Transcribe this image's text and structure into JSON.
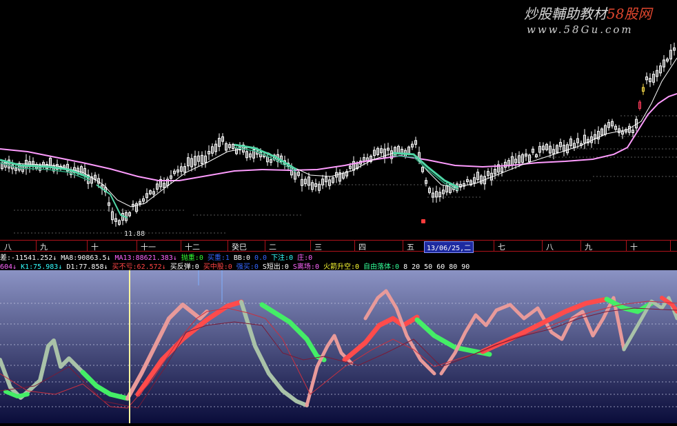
{
  "watermark": {
    "title_main": "炒股輔助教材",
    "title_accent": "58股网",
    "url": "www.58Gu.com"
  },
  "upper_chart": {
    "low_label": "11.88",
    "marker_icon": "red-signal-marker",
    "colors": {
      "candles": "#ffffff",
      "ma_long": "#ff9cff",
      "ma_short_fast": "#ffffff",
      "ma_band": "#4fd6a6",
      "up_candle_highlight": "#ff3b5b",
      "yellow_candle": "#ffe14a"
    }
  },
  "axis": {
    "labels": [
      "八",
      "九",
      "十",
      "十一",
      "十二",
      "癸巳",
      "二",
      "三",
      "四",
      "五",
      "七",
      "八",
      "九",
      "十"
    ],
    "date_box": "13/06/25,二"
  },
  "readout_line1": [
    {
      "text": "差:-11541.252↓",
      "color": "#ffffff"
    },
    {
      "text": "MA8:90863.5↓",
      "color": "#ffffff"
    },
    {
      "text": "MA13:88621.383↓",
      "color": "#ff66ff"
    },
    {
      "text": "抛重:0",
      "color": "#33ff33"
    },
    {
      "text": "买重:1",
      "color": "#3366ff"
    },
    {
      "text": "BB:0",
      "color": "#ffffff"
    },
    {
      "text": "0.0",
      "color": "#3366ff"
    },
    {
      "text": "下注:0",
      "color": "#33ffff"
    },
    {
      "text": "庄:0",
      "color": "#ff66ff"
    }
  ],
  "readout_line2": [
    {
      "text": "604↓",
      "color": "#ff66ff"
    },
    {
      "text": "K1:75.983↓",
      "color": "#33ffff"
    },
    {
      "text": "D1:77.858↓",
      "color": "#ffffff"
    },
    {
      "text": "买不亏:62.572↓",
      "color": "#ff4444"
    },
    {
      "text": "买反弹:0",
      "color": "#ffffff"
    },
    {
      "text": "买中股:0",
      "color": "#ff4444"
    },
    {
      "text": "强买:0",
      "color": "#3366ff"
    },
    {
      "text": "S短出:0",
      "color": "#ffffff"
    },
    {
      "text": "S离场:0",
      "color": "#ff66ff"
    },
    {
      "text": "火箭升空:0",
      "color": "#ffff33"
    },
    {
      "text": "自由落体:0",
      "color": "#33ff99"
    },
    {
      "text": "8",
      "color": "#ffffff"
    },
    {
      "text": "20",
      "color": "#ffffff"
    },
    {
      "text": "50",
      "color": "#ffffff"
    },
    {
      "text": "60",
      "color": "#ffffff"
    },
    {
      "text": "80",
      "color": "#ffffff"
    },
    {
      "text": "90",
      "color": "#ffffff"
    }
  ],
  "lower_panel": {
    "background_top": "#8b93c4",
    "background_bottom": "#0a0c3a",
    "colors": {
      "rise": "#ff4b4b",
      "fall": "#44ee66",
      "pink": "#e89a9a",
      "grey_green": "#a9c2a8",
      "thin_line": "#c83040",
      "cursor": "#fff7a0"
    }
  }
}
